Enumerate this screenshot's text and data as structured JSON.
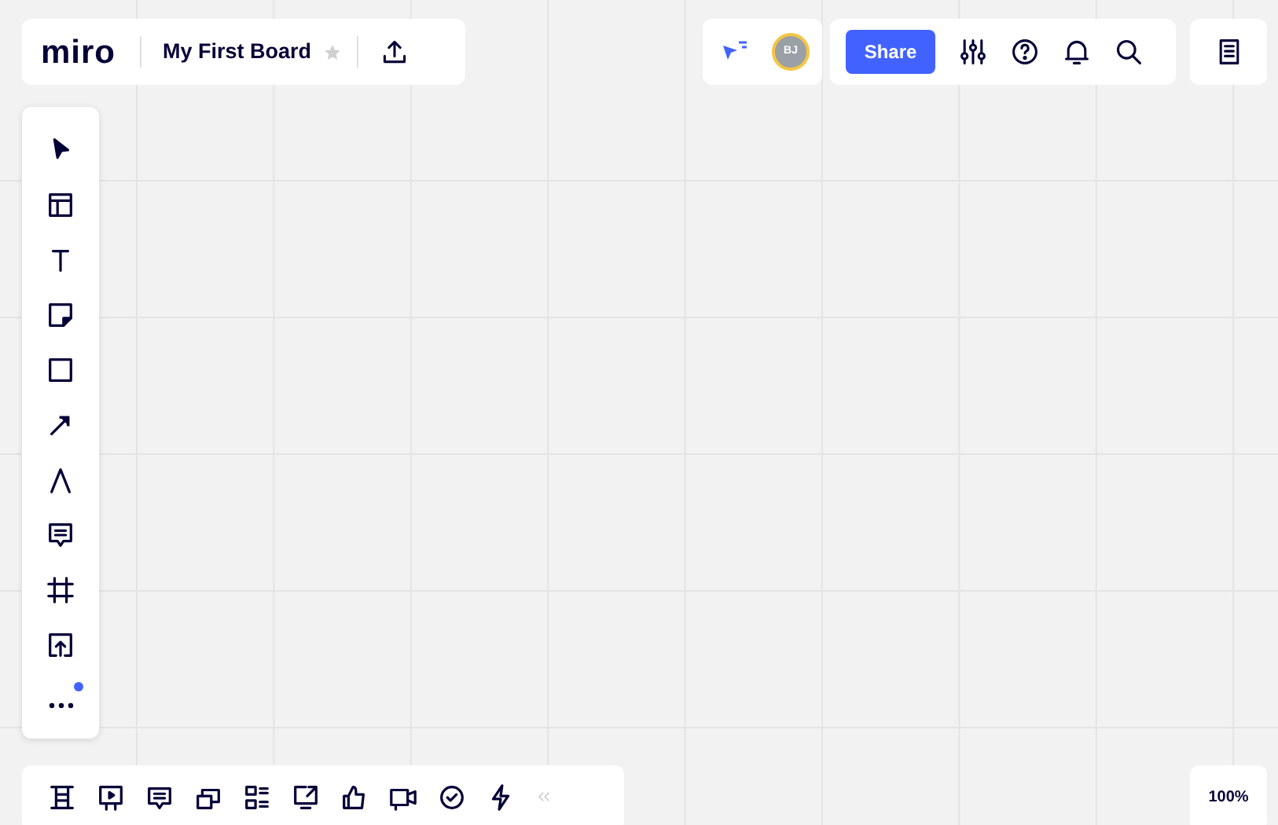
{
  "header": {
    "logo": "miro",
    "board_title": "My First Board",
    "starred": false
  },
  "collaborators": [
    {
      "initials": "BJ",
      "color": "#9aa0a6"
    }
  ],
  "share_button": {
    "label": "Share"
  },
  "toolbar": {
    "more_has_notification": true
  },
  "zoom": {
    "label": "100%"
  }
}
